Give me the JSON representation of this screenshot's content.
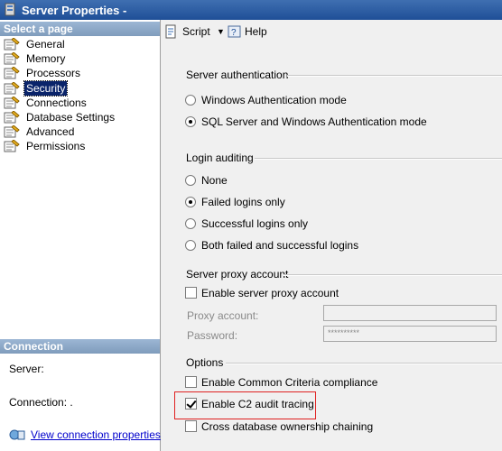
{
  "window": {
    "title": "Server Properties -"
  },
  "sidebar": {
    "header": "Select a page",
    "items": [
      {
        "label": "General",
        "icon": "page-icon"
      },
      {
        "label": "Memory",
        "icon": "page-icon"
      },
      {
        "label": "Processors",
        "icon": "page-icon"
      },
      {
        "label": "Security",
        "icon": "page-icon",
        "selected": true
      },
      {
        "label": "Connections",
        "icon": "page-icon"
      },
      {
        "label": "Database Settings",
        "icon": "page-icon"
      },
      {
        "label": "Advanced",
        "icon": "page-icon"
      },
      {
        "label": "Permissions",
        "icon": "page-icon"
      }
    ]
  },
  "connection": {
    "header": "Connection",
    "server_label": "Server:",
    "connection_label": "Connection: .",
    "link": "View connection properties"
  },
  "toolbar": {
    "script_label": "Script",
    "help_label": "Help"
  },
  "server_auth": {
    "title": "Server authentication",
    "options": [
      {
        "label": "Windows Authentication mode",
        "selected": false
      },
      {
        "label": "SQL Server and Windows Authentication mode",
        "selected": true
      }
    ]
  },
  "login_auditing": {
    "title": "Login auditing",
    "options": [
      {
        "label": "None",
        "selected": false
      },
      {
        "label": "Failed logins only",
        "selected": true
      },
      {
        "label": "Successful logins only",
        "selected": false
      },
      {
        "label": "Both failed and successful logins",
        "selected": false
      }
    ]
  },
  "proxy": {
    "title": "Server proxy account",
    "enable_label": "Enable server proxy account",
    "enable_checked": false,
    "account_label": "Proxy account:",
    "account_value": "",
    "password_label": "Password:",
    "password_value": "**********"
  },
  "options": {
    "title": "Options",
    "items": [
      {
        "label": "Enable Common Criteria compliance",
        "checked": false
      },
      {
        "label": "Enable C2 audit tracing",
        "checked": true
      },
      {
        "label": "Cross database ownership chaining",
        "checked": false
      }
    ]
  },
  "colors": {
    "title_bar": "#1f4f97",
    "selection": "#0a246a",
    "link": "#0000cc",
    "highlight_border": "#e02020"
  }
}
